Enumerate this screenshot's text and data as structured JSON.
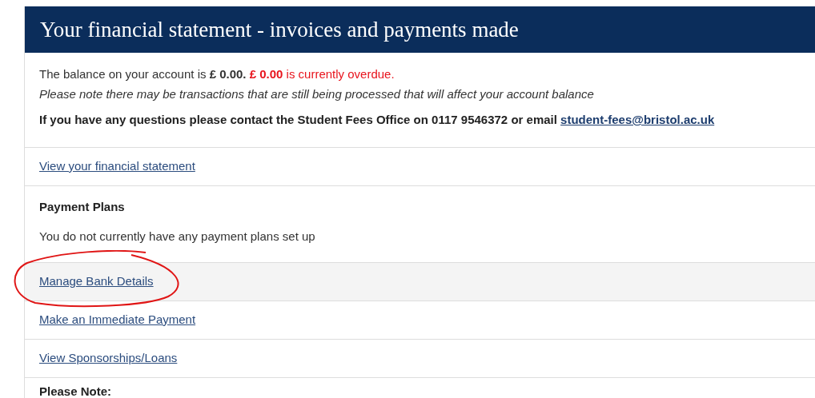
{
  "header": {
    "title": "Your financial statement - invoices and payments made"
  },
  "balance": {
    "text": "The balance on your account is **£ 0.00.**",
    "overdue": "**£ 0.00** is currently overdue."
  },
  "note": "Please note there may be transactions that are still being processed that will affect your account balance",
  "contact": {
    "text": "If you have any questions please contact the Student Fees Office on 0117 9546372 or email",
    "email": "student-fees@bristol.ac.uk"
  },
  "sections": [
    {
      "kind": "link",
      "label": "View your financial statement",
      "highlighted": false
    },
    {
      "kind": "info",
      "heading": "Payment Plans",
      "text": "You do not currently have any payment plans set up"
    },
    {
      "kind": "link",
      "label": "Manage Bank Details",
      "highlighted": true
    },
    {
      "kind": "link",
      "label": "Make an Immediate Payment",
      "highlighted": false
    },
    {
      "kind": "link",
      "label": "View Sponsorships/Loans",
      "highlighted": false
    },
    {
      "kind": "heading",
      "heading": "Please Note:"
    }
  ]
}
